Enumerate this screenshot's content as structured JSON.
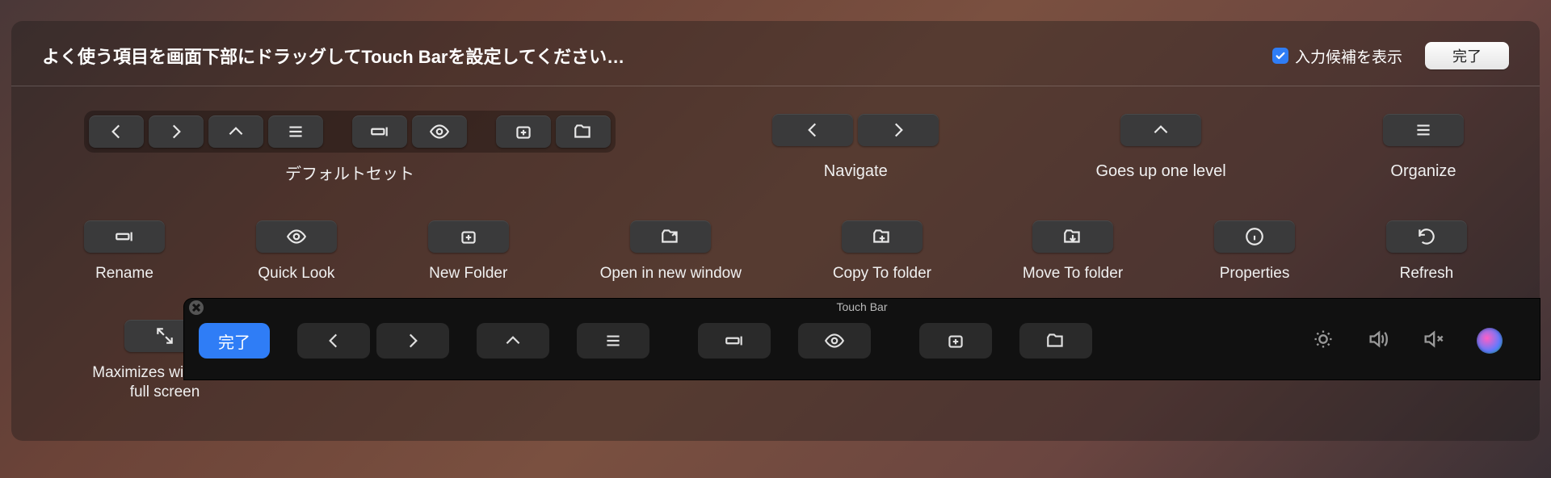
{
  "header": {
    "instruction": "よく使う項目を画面下部にドラッグしてTouch Barを設定してください…",
    "checkbox_checked": true,
    "checkbox_label": "入力候補を表示",
    "done_label": "完了"
  },
  "row1": {
    "default_label": "デフォルトセット",
    "navigate_label": "Navigate",
    "up_label": "Goes up one level",
    "organize_label": "Organize"
  },
  "row2": {
    "rename": "Rename",
    "quicklook": "Quick Look",
    "newfolder": "New Folder",
    "open_new_window": "Open in new window",
    "copy_to": "Copy To folder",
    "move_to": "Move To folder",
    "properties": "Properties",
    "refresh": "Refresh"
  },
  "row3": {
    "maximize": "Maximizes window to full screen"
  },
  "touchbar": {
    "title": "Touch Bar",
    "done": "完了"
  }
}
